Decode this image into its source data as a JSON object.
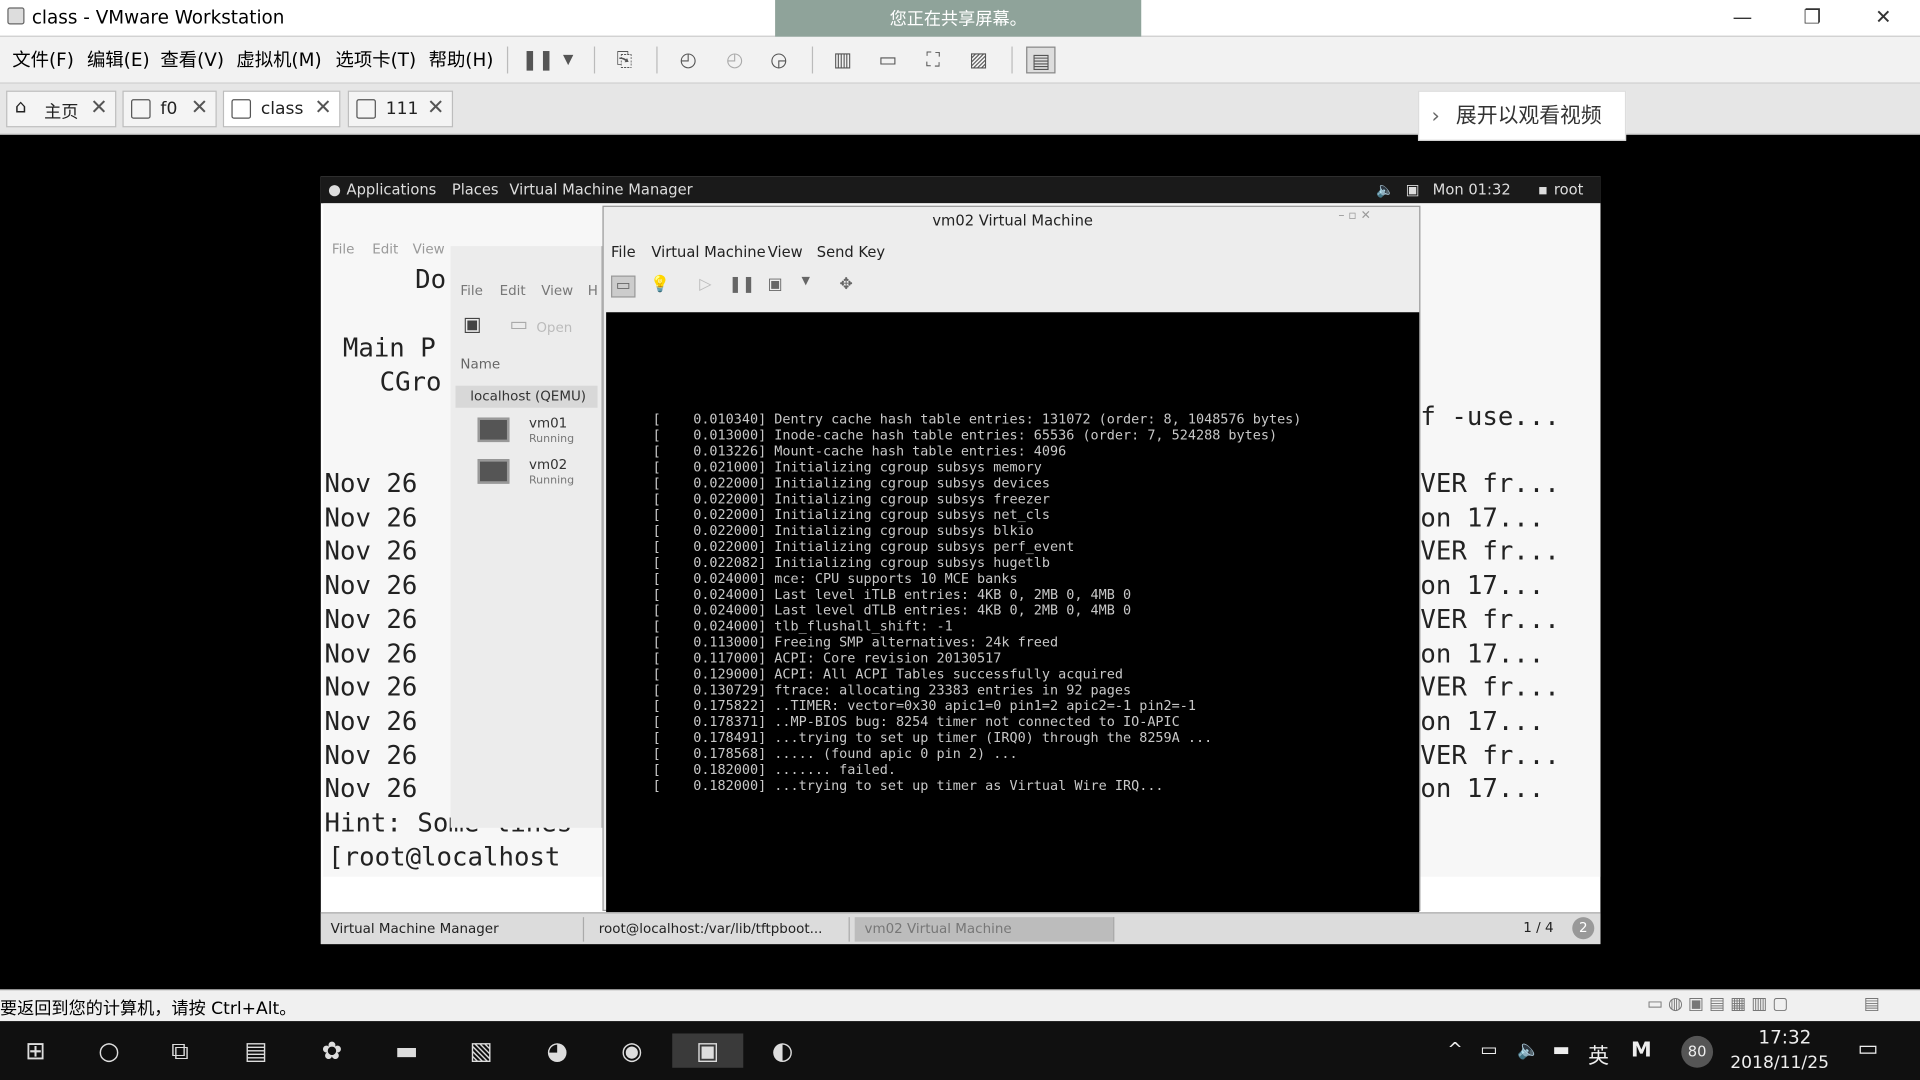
{
  "window": {
    "title": "class - VMware Workstation",
    "share_banner": "您正在共享屏幕。",
    "min": "—",
    "max": "❐",
    "close": "✕"
  },
  "menu": {
    "items": [
      "文件(F)",
      "编辑(E)",
      "查看(V)",
      "虚拟机(M)",
      "选项卡(T)",
      "帮助(H)"
    ]
  },
  "tabs": [
    {
      "label": "主页",
      "icon": "home-icon"
    },
    {
      "label": "f0",
      "icon": "vm-icon"
    },
    {
      "label": "class",
      "icon": "vm-icon"
    },
    {
      "label": "111",
      "icon": "vm-icon"
    }
  ],
  "tab_close": "✕",
  "video_button": {
    "label": "展开以观看视频",
    "chevron": "›"
  },
  "guest": {
    "topbar": {
      "applications": "Applications",
      "places": "Places",
      "app_name": "Virtual Machine Manager",
      "clock": "Mon 01:32",
      "user": "root"
    },
    "bg_terminal": {
      "menus": [
        "File",
        "Edit",
        "View"
      ],
      "lines_left": [
        "Do",
        "Main P",
        "CGro"
      ],
      "log_dates": [
        "Nov 26",
        "Nov 26",
        "Nov 26",
        "Nov 26",
        "Nov 26",
        "Nov 26",
        "Nov 26",
        "Nov 26",
        "Nov 26",
        "Nov 26"
      ],
      "right_col": [
        "f -use...",
        "VER fr...",
        "on 17...",
        "VER fr...",
        "on 17...",
        "VER fr...",
        "on 17...",
        "VER fr...",
        "on 17...",
        "VER fr...",
        "on 17..."
      ],
      "hint": "Hint: Some lines",
      "prompt": "[root@localhost"
    },
    "vmm": {
      "menus": [
        "File",
        "Edit",
        "View",
        "H"
      ],
      "open_label": "Open",
      "name_header": "Name",
      "host": "localhost (QEMU)",
      "vms": [
        {
          "name": "vm01",
          "state": "Running"
        },
        {
          "name": "vm02",
          "state": "Running"
        }
      ]
    },
    "vmwin": {
      "title": "vm02 Virtual Machine",
      "menus": [
        "File",
        "Virtual Machine",
        "View",
        "Send Key"
      ],
      "console_lines": [
        "[    0.010340] Dentry cache hash table entries: 131072 (order: 8, 1048576 bytes)",
        "[    0.013000] Inode-cache hash table entries: 65536 (order: 7, 524288 bytes)",
        "[    0.013226] Mount-cache hash table entries: 4096",
        "[    0.021000] Initializing cgroup subsys memory",
        "[    0.022000] Initializing cgroup subsys devices",
        "[    0.022000] Initializing cgroup subsys freezer",
        "[    0.022000] Initializing cgroup subsys net_cls",
        "[    0.022000] Initializing cgroup subsys blkio",
        "[    0.022000] Initializing cgroup subsys perf_event",
        "[    0.022082] Initializing cgroup subsys hugetlb",
        "[    0.024000] mce: CPU supports 10 MCE banks",
        "[    0.024000] Last level iTLB entries: 4KB 0, 2MB 0, 4MB 0",
        "[    0.024000] Last level dTLB entries: 4KB 0, 2MB 0, 4MB 0",
        "[    0.024000] tlb_flushall_shift: -1",
        "[    0.113000] Freeing SMP alternatives: 24k freed",
        "[    0.117000] ACPI: Core revision 20130517",
        "[    0.129000] ACPI: All ACPI Tables successfully acquired",
        "[    0.130729] ftrace: allocating 23383 entries in 92 pages",
        "[    0.175822] ..TIMER: vector=0x30 apic1=0 pin1=2 apic2=-1 pin2=-1",
        "[    0.178371] ..MP-BIOS bug: 8254 timer not connected to IO-APIC",
        "[    0.178491] ...trying to set up timer (IRQ0) through the 8259A ...",
        "[    0.178568] ..... (found apic 0 pin 2) ...",
        "[    0.182000] ....... failed.",
        "[    0.182000] ...trying to set up timer as Virtual Wire IRQ..."
      ]
    },
    "taskbar": {
      "items": [
        "Virtual Machine Manager",
        "root@localhost:/var/lib/tftpboot...",
        "vm02 Virtual Machine"
      ],
      "pager": "1 / 4",
      "badge": "2"
    }
  },
  "statusbar": {
    "text": "要返回到您的计算机，请按 Ctrl+Alt。"
  },
  "os_taskbar": {
    "ime": "英",
    "ime2": "M",
    "badge": "80",
    "time": "17:32",
    "date": "2018/11/25"
  }
}
